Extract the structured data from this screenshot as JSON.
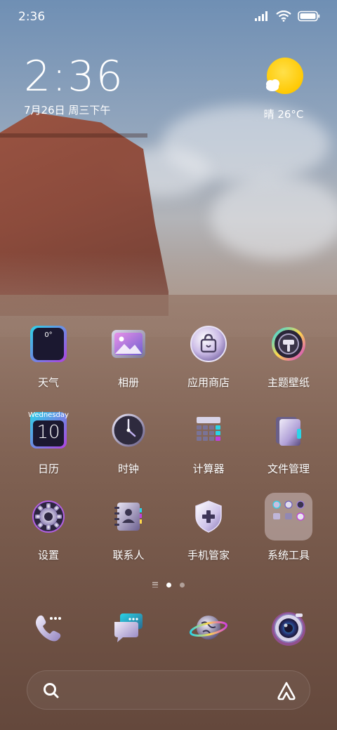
{
  "status_bar": {
    "time": "2:36",
    "icons": [
      "signal-icon",
      "wifi-icon",
      "battery-icon"
    ]
  },
  "clock_widget": {
    "time": "2:36",
    "date": "7月26日 周三下午"
  },
  "weather_widget": {
    "icon": "sunny-cloud-icon",
    "text": "晴 26°C"
  },
  "apps": [
    {
      "id": "weather",
      "label": "天气",
      "icon": "weather-app-icon",
      "icon_text": "0°"
    },
    {
      "id": "gallery",
      "label": "相册",
      "icon": "gallery-app-icon"
    },
    {
      "id": "app-store",
      "label": "应用商店",
      "icon": "app-store-icon"
    },
    {
      "id": "themes",
      "label": "主题壁纸",
      "icon": "themes-app-icon"
    },
    {
      "id": "calendar",
      "label": "日历",
      "icon": "calendar-app-icon",
      "icon_weekday": "Wednesday",
      "icon_day": "10"
    },
    {
      "id": "clock",
      "label": "时钟",
      "icon": "clock-app-icon"
    },
    {
      "id": "calculator",
      "label": "计算器",
      "icon": "calculator-app-icon"
    },
    {
      "id": "file-manager",
      "label": "文件管理",
      "icon": "file-manager-icon"
    },
    {
      "id": "settings",
      "label": "设置",
      "icon": "settings-app-icon"
    },
    {
      "id": "contacts",
      "label": "联系人",
      "icon": "contacts-app-icon"
    },
    {
      "id": "security",
      "label": "手机管家",
      "icon": "security-app-icon"
    },
    {
      "id": "tools-folder",
      "label": "系统工具",
      "icon": "tools-folder-icon"
    }
  ],
  "page_indicator": {
    "pages": 2,
    "active": 1
  },
  "dock": [
    {
      "id": "phone",
      "icon": "phone-app-icon"
    },
    {
      "id": "messages",
      "icon": "messages-app-icon"
    },
    {
      "id": "browser",
      "icon": "browser-app-icon"
    },
    {
      "id": "camera",
      "icon": "camera-app-icon"
    }
  ],
  "search_bar": {
    "left_icon": "search-icon",
    "right_icon": "assistant-icon"
  },
  "colors": {
    "accent_cyan": "#2ad4e8",
    "accent_purple": "#b040e0",
    "sun_yellow": "#ffd21e"
  }
}
